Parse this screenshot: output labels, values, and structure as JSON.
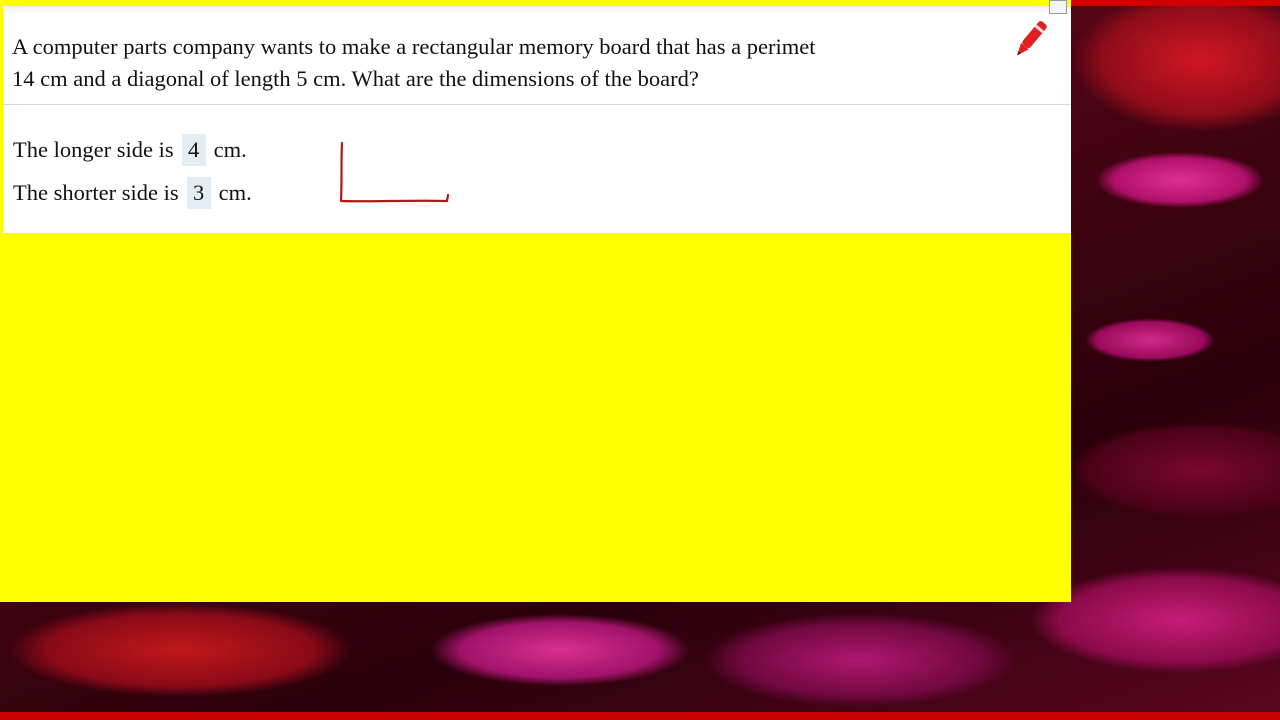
{
  "question": {
    "line1": "A computer parts company wants to make a rectangular memory board that has a perimet",
    "line2": "14 cm and a diagonal of length 5 cm. What are the dimensions of the board?"
  },
  "answers": {
    "longer": {
      "prefix": "The longer side is",
      "value": "4",
      "unit": "cm."
    },
    "shorter": {
      "prefix": "The shorter side is",
      "value": "3",
      "unit": "cm."
    }
  },
  "icons": {
    "pen": "pen-tool-icon",
    "resize": "restore-window-icon"
  },
  "colors": {
    "panel_background": "#ffff00",
    "answer_box": "#e4ecf4",
    "ink": "#b01818"
  }
}
